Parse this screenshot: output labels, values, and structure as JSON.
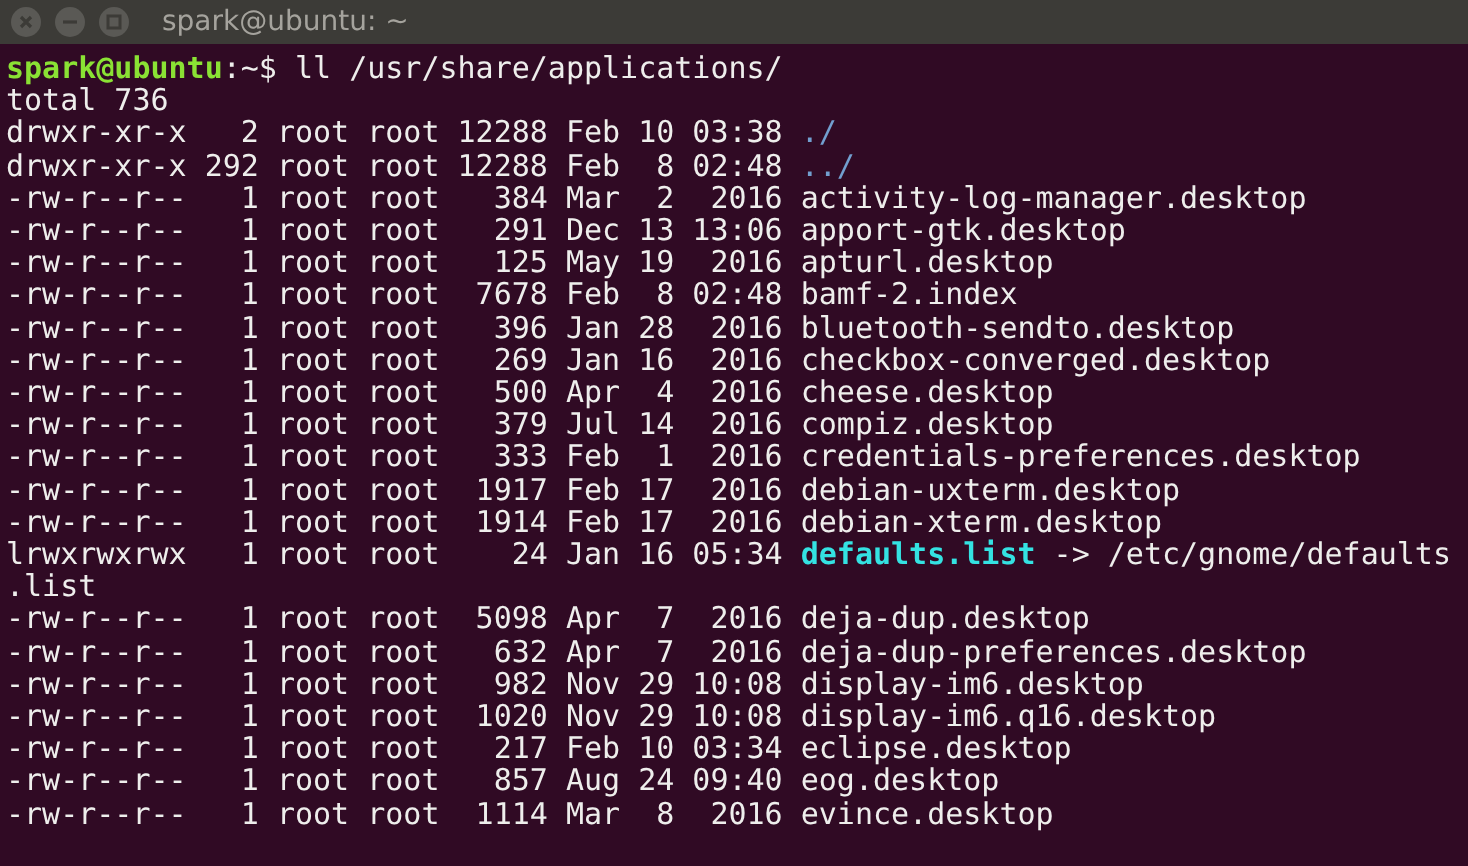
{
  "window": {
    "title": "spark@ubuntu: ~"
  },
  "terminal": {
    "prompt": {
      "user_host": "spark@ubuntu",
      "path": ":~$ ",
      "command": "ll /usr/share/applications/"
    },
    "summary": "total 736",
    "lines": [
      {
        "details": "drwxr-xr-x   2 root root 12288 Feb 10 03:38 ",
        "name": "./",
        "kind": "dir"
      },
      {
        "details": "drwxr-xr-x 292 root root 12288 Feb  8 02:48 ",
        "name": "../",
        "kind": "dir"
      },
      {
        "details": "-rw-r--r--   1 root root   384 Mar  2  2016 ",
        "name": "activity-log-manager.desktop",
        "kind": "file"
      },
      {
        "details": "-rw-r--r--   1 root root   291 Dec 13 13:06 ",
        "name": "apport-gtk.desktop",
        "kind": "file"
      },
      {
        "details": "-rw-r--r--   1 root root   125 May 19  2016 ",
        "name": "apturl.desktop",
        "kind": "file"
      },
      {
        "details": "-rw-r--r--   1 root root  7678 Feb  8 02:48 ",
        "name": "bamf-2.index",
        "kind": "file"
      },
      {
        "details": "-rw-r--r--   1 root root   396 Jan 28  2016 ",
        "name": "bluetooth-sendto.desktop",
        "kind": "file"
      },
      {
        "details": "-rw-r--r--   1 root root   269 Jan 16  2016 ",
        "name": "checkbox-converged.desktop",
        "kind": "file"
      },
      {
        "details": "-rw-r--r--   1 root root   500 Apr  4  2016 ",
        "name": "cheese.desktop",
        "kind": "file"
      },
      {
        "details": "-rw-r--r--   1 root root   379 Jul 14  2016 ",
        "name": "compiz.desktop",
        "kind": "file"
      },
      {
        "details": "-rw-r--r--   1 root root   333 Feb  1  2016 ",
        "name": "credentials-preferences.desktop",
        "kind": "file"
      },
      {
        "details": "-rw-r--r--   1 root root  1917 Feb 17  2016 ",
        "name": "debian-uxterm.desktop",
        "kind": "file"
      },
      {
        "details": "-rw-r--r--   1 root root  1914 Feb 17  2016 ",
        "name": "debian-xterm.desktop",
        "kind": "file"
      },
      {
        "details": "lrwxrwxrwx   1 root root    24 Jan 16 05:34 ",
        "name": "defaults.list",
        "kind": "link",
        "target": " -> /etc/gnome/defaults",
        "target_continued": ".list"
      },
      {
        "details": "-rw-r--r--   1 root root  5098 Apr  7  2016 ",
        "name": "deja-dup.desktop",
        "kind": "file"
      },
      {
        "details": "-rw-r--r--   1 root root   632 Apr  7  2016 ",
        "name": "deja-dup-preferences.desktop",
        "kind": "file"
      },
      {
        "details": "-rw-r--r--   1 root root   982 Nov 29 10:08 ",
        "name": "display-im6.desktop",
        "kind": "file"
      },
      {
        "details": "-rw-r--r--   1 root root  1020 Nov 29 10:08 ",
        "name": "display-im6.q16.desktop",
        "kind": "file"
      },
      {
        "details": "-rw-r--r--   1 root root   217 Feb 10 03:34 ",
        "name": "eclipse.desktop",
        "kind": "file"
      },
      {
        "details": "-rw-r--r--   1 root root   857 Aug 24 09:40 ",
        "name": "eog.desktop",
        "kind": "file"
      },
      {
        "details": "-rw-r--r--   1 root root  1114 Mar  8  2016 ",
        "name": "evince.desktop",
        "kind": "file"
      }
    ]
  }
}
